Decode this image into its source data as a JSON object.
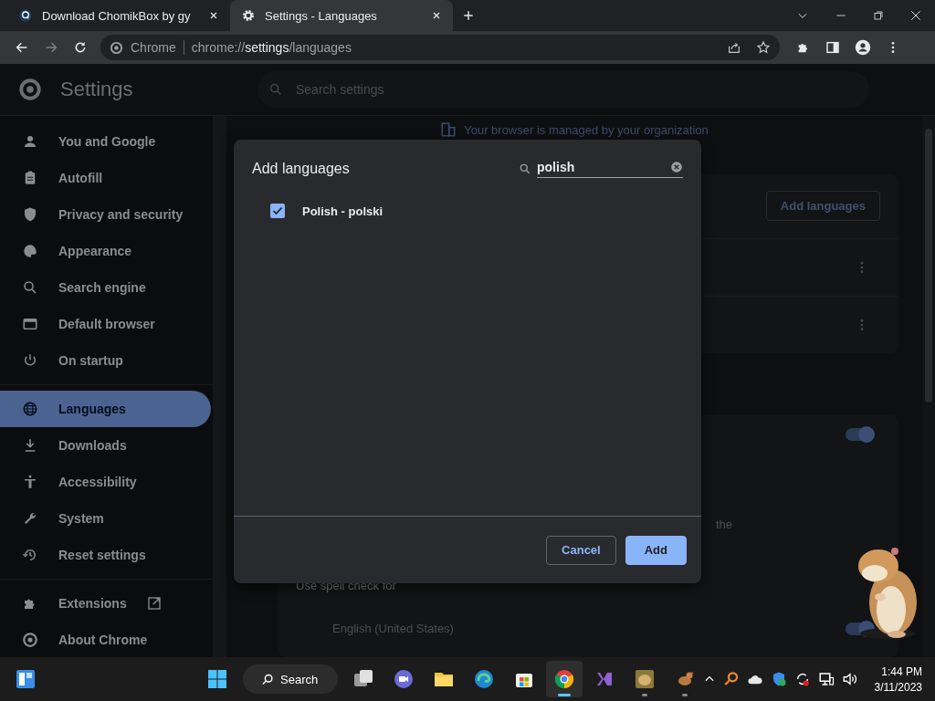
{
  "browser": {
    "tabs": [
      {
        "title": "Download ChomikBox by gy",
        "selected": false
      },
      {
        "title": "Settings - Languages",
        "selected": true
      }
    ],
    "address_bar": {
      "site_label": "Chrome",
      "url_scheme": "chrome://",
      "url_host": "settings",
      "url_path": "/languages"
    }
  },
  "settings": {
    "title": "Settings",
    "search": {
      "placeholder": "Search settings"
    },
    "sidebar": {
      "sections": [
        [
          {
            "label": "You and Google",
            "selected": false
          },
          {
            "label": "Autofill",
            "selected": false
          },
          {
            "label": "Privacy and security",
            "selected": false
          },
          {
            "label": "Appearance",
            "selected": false
          },
          {
            "label": "Search engine",
            "selected": false
          },
          {
            "label": "Default browser",
            "selected": false
          },
          {
            "label": "On startup",
            "selected": false
          }
        ],
        [
          {
            "label": "Languages",
            "selected": true
          },
          {
            "label": "Downloads",
            "selected": false
          },
          {
            "label": "Accessibility",
            "selected": false
          },
          {
            "label": "System",
            "selected": false
          },
          {
            "label": "Reset settings",
            "selected": false
          }
        ],
        [
          {
            "label": "Extensions",
            "selected": false,
            "external": true
          },
          {
            "label": "About Chrome",
            "selected": false,
            "external": false
          }
        ]
      ]
    },
    "managed_notice": "Your browser is managed by your organization",
    "languages_card": {
      "button": "Add languages"
    },
    "spell_card": {
      "toggle_on": true,
      "partial_text": "the",
      "spell_check_label": "Use spell check for",
      "languages": [
        {
          "name": "English (United States)",
          "on": true
        }
      ]
    }
  },
  "dialog": {
    "title": "Add languages",
    "search": {
      "value": "polish"
    },
    "options": [
      {
        "label": "Polish - polski",
        "checked": true
      }
    ],
    "cancel": "Cancel",
    "confirm": "Add"
  },
  "taskbar": {
    "search": "Search",
    "time": "1:44 PM",
    "date": "3/11/2023",
    "apps": [
      {
        "selected": false,
        "running": false
      },
      {
        "selected": false,
        "running": false
      },
      {
        "selected": false,
        "running": false
      },
      {
        "selected": false,
        "running": false
      },
      {
        "selected": false,
        "running": false
      },
      {
        "selected": true,
        "running": true
      },
      {
        "selected": false,
        "running": false
      },
      {
        "selected": false,
        "running": true
      },
      {
        "selected": false,
        "running": true
      }
    ]
  }
}
